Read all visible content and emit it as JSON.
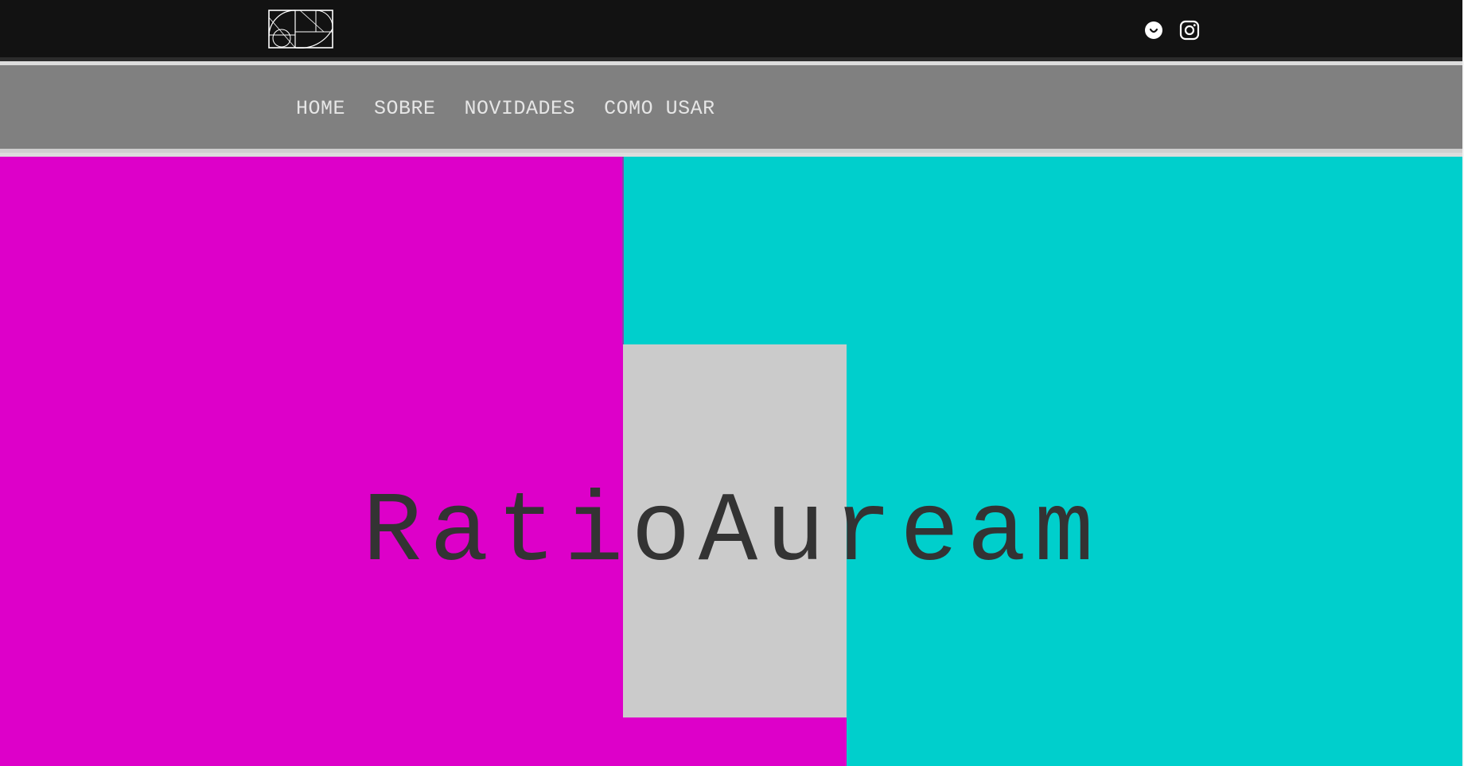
{
  "header": {
    "logo_icon": "golden-ratio-logo-icon",
    "social": [
      {
        "name": "ello-icon"
      },
      {
        "name": "instagram-icon"
      }
    ]
  },
  "nav": {
    "items": [
      {
        "label": "HOME"
      },
      {
        "label": "SOBRE"
      },
      {
        "label": "NOVIDADES"
      },
      {
        "label": "COMO USAR"
      }
    ]
  },
  "hero": {
    "title": "RatioAuream",
    "colors": {
      "magenta": "#dd00c9",
      "cyan": "#00cfcc",
      "gray": "#cbcbcb",
      "title": "#333333"
    }
  }
}
